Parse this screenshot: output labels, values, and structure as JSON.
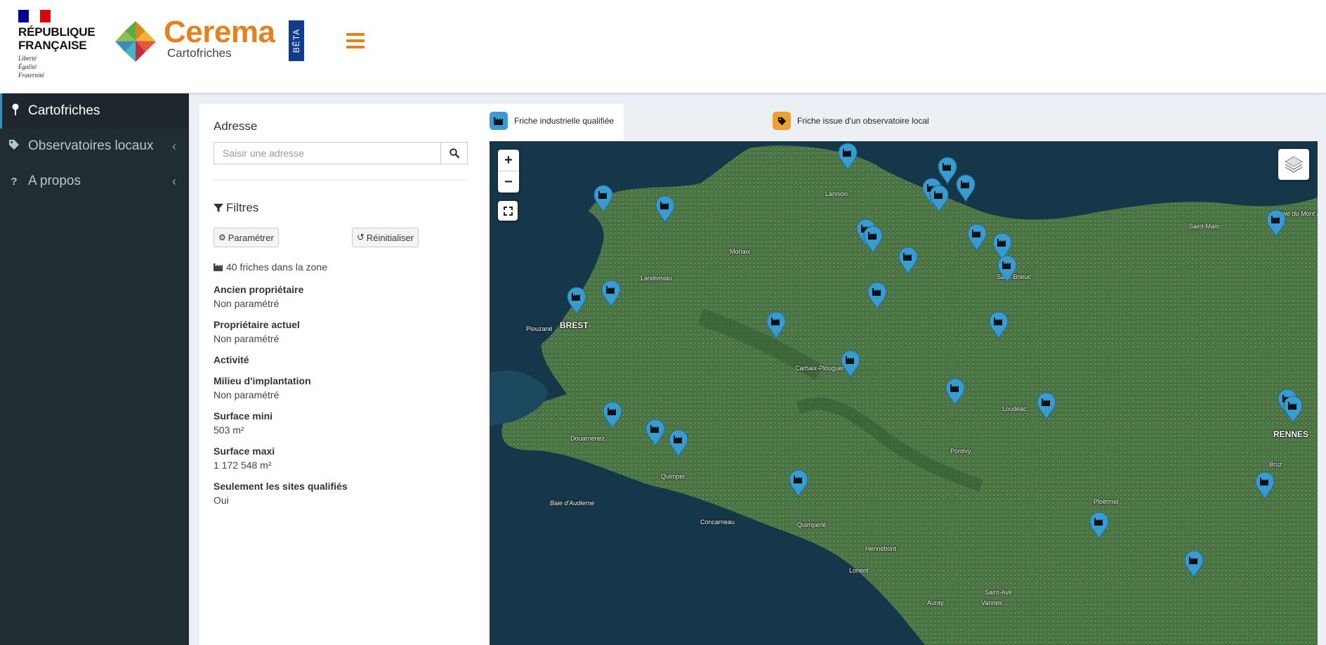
{
  "header": {
    "rf_title_line1": "RÉPUBLIQUE",
    "rf_title_line2": "FRANÇAISE",
    "rf_motto_1": "Liberté",
    "rf_motto_2": "Égalité",
    "rf_motto_3": "Fraternité",
    "brand_name": "Cerema",
    "brand_sub": "Cartofriches",
    "beta": "BÊTA"
  },
  "colors": {
    "accent": "#e6821e",
    "sidebar": "#222d32",
    "industrial_marker": "#3a9bd0",
    "observatory_marker": "#f0a030",
    "beta_bg": "#0f3c8c"
  },
  "sidebar": {
    "items": [
      {
        "label": "Cartofriches",
        "icon": "map-pin-icon"
      },
      {
        "label": "Observatoires locaux",
        "icon": "tag-icon"
      },
      {
        "label": "A propos",
        "icon": "question-icon"
      }
    ]
  },
  "search": {
    "label": "Adresse",
    "placeholder": "Saisir une adresse",
    "value": ""
  },
  "filters": {
    "title": "Filtres",
    "param_btn": "Paramétrer",
    "reset_btn": "Réinitialiser",
    "count": "40 friches dans la zone",
    "items": [
      {
        "label": "Ancien propriétaire",
        "value": "Non paramétré"
      },
      {
        "label": "Propriétaire actuel",
        "value": "Non paramétré"
      },
      {
        "label": "Activité",
        "value": ""
      },
      {
        "label": "Milieu d'implantation",
        "value": "Non paramétré"
      },
      {
        "label": "Surface mini",
        "value": "503 m²"
      },
      {
        "label": "Surface maxi",
        "value": "1 172 548 m²"
      },
      {
        "label": "Seulement les sites qualifiés",
        "value": "Oui"
      }
    ]
  },
  "legend": {
    "industrial": "Friche industrielle qualifiée",
    "observatory": "Friche issue d'un observatoire local"
  },
  "map": {
    "zoom_in": "+",
    "zoom_out": "−",
    "cities": [
      "Lannion",
      "Morlaix",
      "Landivisiau",
      "Plouzané",
      "BREST",
      "Carhaix-Plouguer",
      "Loudéac",
      "Pontivy",
      "Douarnenez",
      "Quimper",
      "Baie d'Audierne",
      "Concarneau",
      "Quimperlé",
      "Hennebont",
      "Lorient",
      "Auray",
      "Saint-Avé",
      "Vannes",
      "Ploërmel",
      "Saint-Malo",
      "Baie du Mont Saint-Michel",
      "RENNES",
      "Bruz",
      "Saint-Brieuc"
    ]
  }
}
